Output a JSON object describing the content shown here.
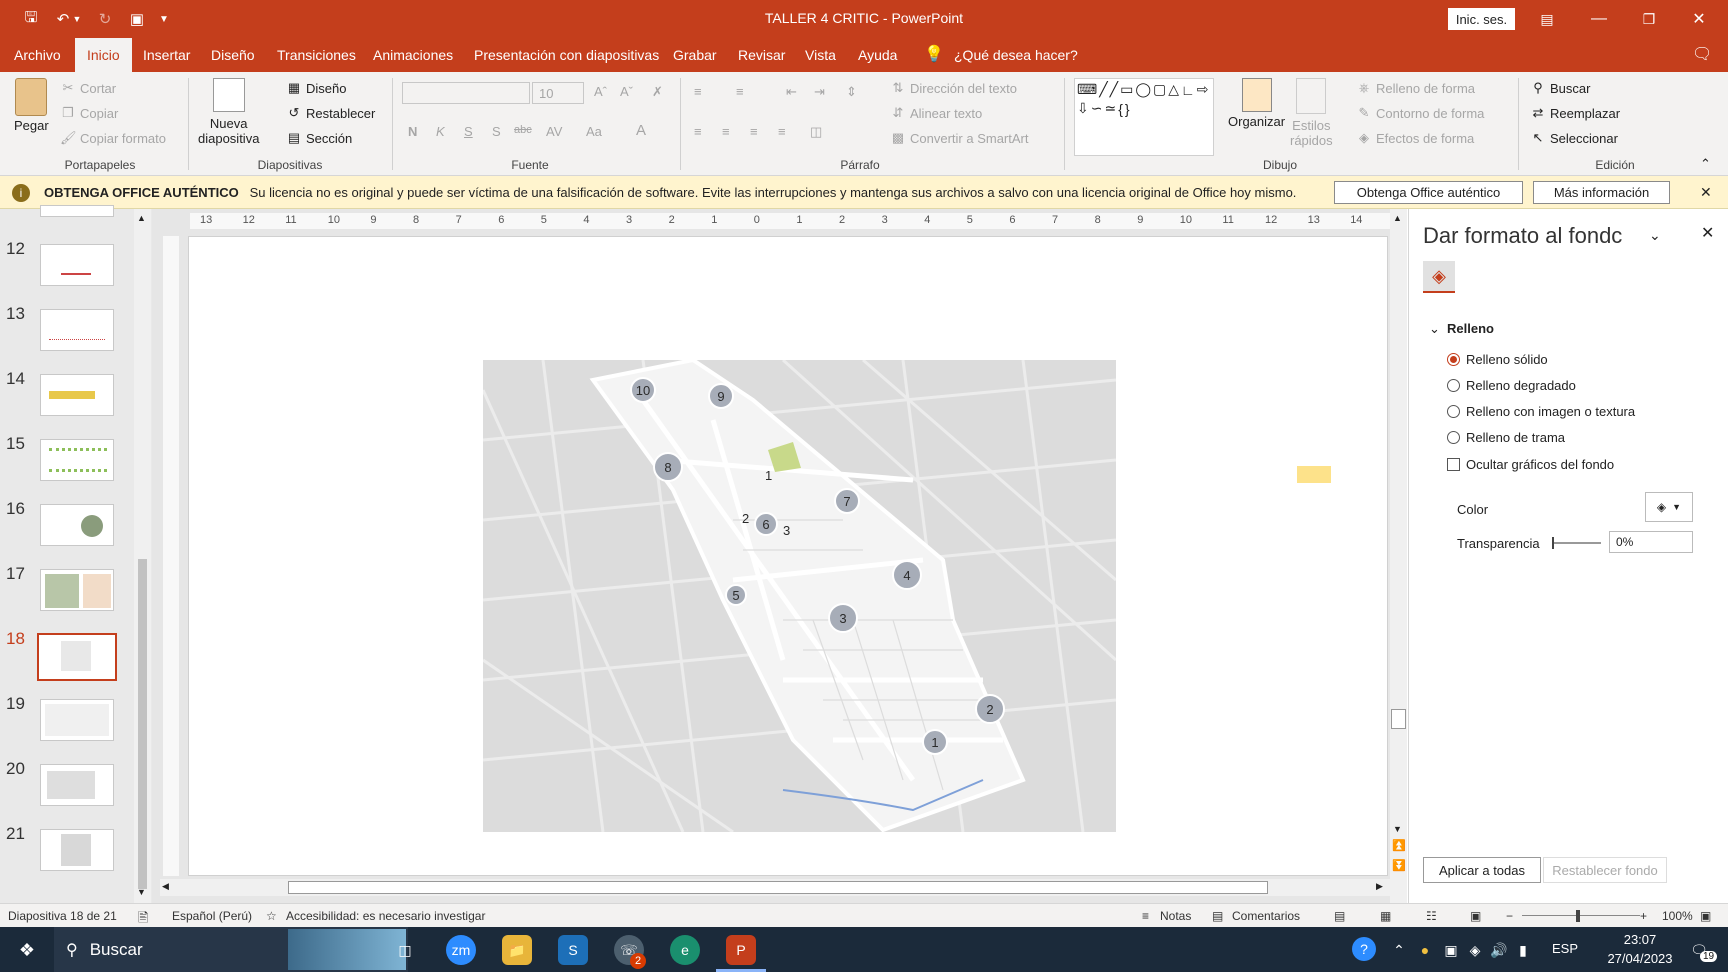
{
  "window": {
    "title": "TALLER 4 CRITIC  -  PowerPoint",
    "signin_label": "Inic. ses."
  },
  "tabs": [
    "Archivo",
    "Inicio",
    "Insertar",
    "Diseño",
    "Transiciones",
    "Animaciones",
    "Presentación con diapositivas",
    "Grabar",
    "Revisar",
    "Vista",
    "Ayuda"
  ],
  "tell_me": "¿Qué desea hacer?",
  "ribbon": {
    "clipboard": {
      "paste": "Pegar",
      "cut": "Cortar",
      "copy": "Copiar",
      "format_painter": "Copiar formato",
      "group": "Portapapeles"
    },
    "slides": {
      "new_slide_1": "Nueva",
      "new_slide_2": "diapositiva",
      "layout": "Diseño",
      "reset": "Restablecer",
      "section": "Sección",
      "group": "Diapositivas"
    },
    "font": {
      "size": "10",
      "bold": "N",
      "italic": "K",
      "underline": "S",
      "shadow": "S",
      "strike": "abc",
      "group": "Fuente"
    },
    "paragraph": {
      "text_direction": "Dirección del texto",
      "align_text": "Alinear texto",
      "smartart": "Convertir a SmartArt",
      "group": "Párrafo"
    },
    "drawing": {
      "arrange": "Organizar",
      "quick_styles_1": "Estilos",
      "quick_styles_2": "rápidos",
      "shape_fill": "Relleno de forma",
      "shape_outline": "Contorno de forma",
      "shape_effects": "Efectos de forma",
      "group": "Dibujo"
    },
    "editing": {
      "find": "Buscar",
      "replace": "Reemplazar",
      "select": "Seleccionar",
      "group": "Edición"
    }
  },
  "message_bar": {
    "title": "OBTENGA OFFICE AUTÉNTICO",
    "text": "Su licencia no es original y puede ser víctima de una falsificación de software. Evite las interrupciones y mantenga sus archivos a salvo con una licencia original de Office hoy mismo.",
    "btn_genuine": "Obtenga Office auténtico",
    "btn_more": "Más información"
  },
  "thumbnails": [
    {
      "num": "12"
    },
    {
      "num": "13"
    },
    {
      "num": "14"
    },
    {
      "num": "15"
    },
    {
      "num": "16"
    },
    {
      "num": "17"
    },
    {
      "num": "18"
    },
    {
      "num": "19"
    },
    {
      "num": "20"
    },
    {
      "num": "21"
    }
  ],
  "ruler": {
    "h_ticks": [
      "13",
      "12",
      "11",
      "10",
      "9",
      "8",
      "7",
      "6",
      "5",
      "4",
      "3",
      "2",
      "1",
      "0",
      "1",
      "2",
      "3",
      "4",
      "5",
      "6",
      "7",
      "8",
      "9",
      "10",
      "11",
      "12",
      "13",
      "14"
    ]
  },
  "map_markers": {
    "gray": [
      "10",
      "9",
      "8",
      "7",
      "6",
      "4",
      "5",
      "3",
      "2",
      "1"
    ],
    "yellow": [
      "1",
      "2",
      "3"
    ]
  },
  "panel": {
    "title": "Dar formato al fondc",
    "section": "Relleno",
    "options": [
      "Relleno sólido",
      "Relleno degradado",
      "Relleno con imagen o textura",
      "Relleno de trama"
    ],
    "hide_graphics": "Ocultar gráficos del fondo",
    "color_label": "Color",
    "transparency_label": "Transparencia",
    "transparency_value": "0%",
    "apply_all": "Aplicar a todas",
    "reset_bg": "Restablecer fondo"
  },
  "status": {
    "slide": "Diapositiva 18 de 21",
    "language": "Español (Perú)",
    "accessibility": "Accesibilidad: es necesario investigar",
    "notes": "Notas",
    "comments": "Comentarios",
    "zoom": "100%"
  },
  "taskbar": {
    "search": "Buscar",
    "lang": "ESP",
    "time": "23:07",
    "date": "27/04/2023",
    "notif": "19",
    "whatsapp_badge": "2"
  }
}
